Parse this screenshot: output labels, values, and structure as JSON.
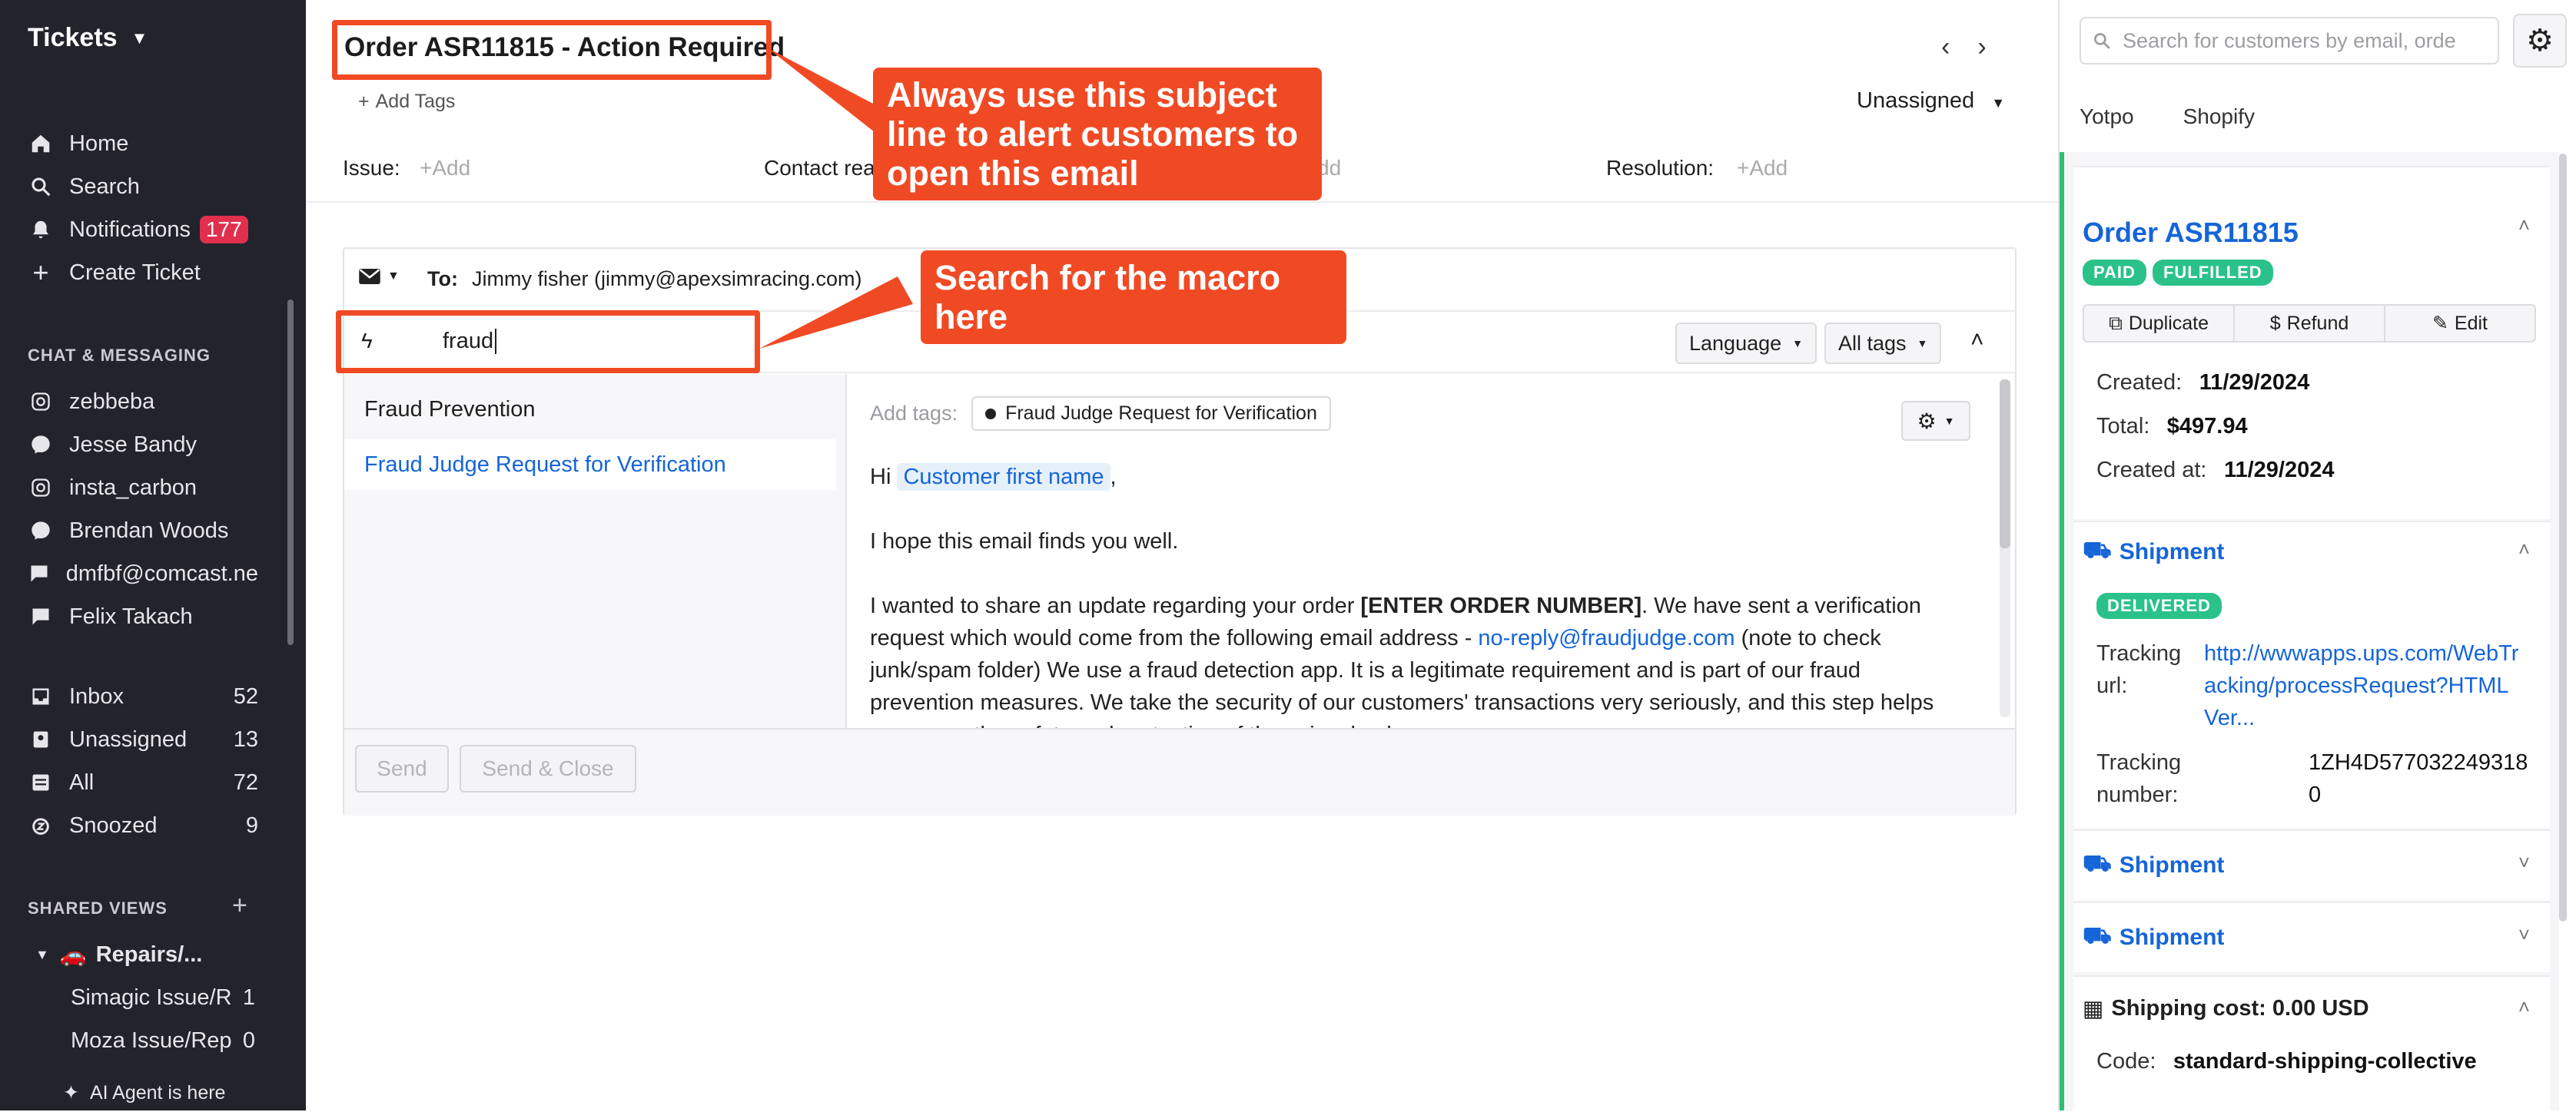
{
  "sidebar": {
    "title": "Tickets",
    "nav": [
      {
        "label": "Home",
        "icon": "home-icon"
      },
      {
        "label": "Search",
        "icon": "search-icon"
      },
      {
        "label": "Notifications",
        "icon": "bell-icon",
        "badge": "177"
      },
      {
        "label": "Create Ticket",
        "icon": "plus-icon"
      }
    ],
    "chat_section": "CHAT & MESSAGING",
    "chats": [
      {
        "label": "zebbeba",
        "icon": "instagram-icon"
      },
      {
        "label": "Jesse Bandy",
        "icon": "messenger-icon"
      },
      {
        "label": "insta_carbon",
        "icon": "instagram-icon"
      },
      {
        "label": "Brendan Woods",
        "icon": "messenger-icon"
      },
      {
        "label": "dmfbf@comcast.ne",
        "icon": "chat-icon"
      },
      {
        "label": "Felix Takach",
        "icon": "chat-icon"
      }
    ],
    "views": [
      {
        "label": "Inbox",
        "count": "52",
        "icon": "inbox-icon"
      },
      {
        "label": "Unassigned",
        "count": "13",
        "icon": "unassigned-icon"
      },
      {
        "label": "All",
        "count": "72",
        "icon": "all-icon"
      },
      {
        "label": "Snoozed",
        "count": "9",
        "icon": "snooze-icon"
      }
    ],
    "shared_section": "SHARED VIEWS",
    "shared_folder": "Repairs/...",
    "shared_views": [
      {
        "label": "Simagic Issue/R",
        "count": "1"
      },
      {
        "label": "Moza Issue/Rep",
        "count": "0"
      }
    ],
    "ai_agent": "AI Agent is here"
  },
  "ticket": {
    "subject": "Order ASR11815 - Action Required",
    "add_tags": "Add Tags",
    "assignee": "Unassigned",
    "fields": {
      "issue_label": "Issue:",
      "issue_value": "+Add",
      "contact_label": "Contact rea",
      "mid_value": "dd",
      "resolution_label": "Resolution:",
      "resolution_value": "+Add"
    }
  },
  "callouts": {
    "subject_note": "Always use this subject line to alert customers to open this email",
    "macro_note": "Search for the macro here"
  },
  "editor": {
    "to_label": "To:",
    "to_value": "Jimmy fisher (jimmy@apexsimracing.com)",
    "macro_search": "fraud",
    "language": "Language",
    "all_tags": "All tags",
    "macros": [
      "Fraud Prevention",
      "Fraud Judge Request for Verification"
    ],
    "add_tags_label": "Add tags:",
    "tag": "Fraud Judge Request for Verification",
    "greeting_hi": "Hi",
    "greeting_var": "Customer first name",
    "greeting_comma": ",",
    "line1": "I hope this email finds you well.",
    "body_a": "I wanted to share an update regarding your order",
    "body_bold": "[ENTER ORDER NUMBER]",
    "body_b": ". We have sent a verification request which would come from the following email address -",
    "body_link": "no-reply@fraudjudge.com",
    "body_c": "(note to check junk/spam folder) We use a fraud detection app. It is a legitimate requirement and is part of our fraud prevention measures. We take the security of our customers' transactions very seriously, and this step helps us ensure the safety and protection of those involved.",
    "send": "Send",
    "send_close": "Send & Close"
  },
  "right_panel": {
    "search_placeholder": "Search for customers by email, orde",
    "tabs": [
      "Yotpo",
      "Shopify"
    ],
    "order": {
      "title": "Order ASR11815",
      "badges": [
        "PAID",
        "FULFILLED"
      ],
      "actions": [
        "Duplicate",
        "Refund",
        "Edit"
      ],
      "created_label": "Created:",
      "created": "11/29/2024",
      "total_label": "Total:",
      "total": "$497.94",
      "created_at_label": "Created at:",
      "created_at": "11/29/2024"
    },
    "shipment": {
      "title": "Shipment",
      "status": "DELIVERED",
      "tracking_url_label": "Tracking url:",
      "tracking_url": "http://wwwapps.ups.com/WebTracking/processRequest?HTMLVer...",
      "tracking_number_label": "Tracking number:",
      "tracking_number": "1ZH4D5770322493180"
    },
    "shipment2": "Shipment",
    "shipment3": "Shipment",
    "shipping_cost": "Shipping cost: 0.00 USD",
    "code_label": "Code:",
    "code": "standard-shipping-collective"
  },
  "colors": {
    "accent": "#f04a25",
    "link": "#1565d8",
    "green": "#2fbf71",
    "sidebar": "#23232b"
  }
}
